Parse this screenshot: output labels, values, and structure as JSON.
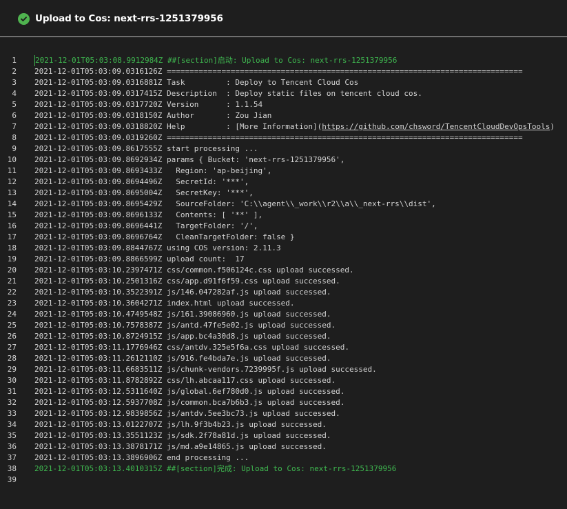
{
  "header": {
    "title": "Upload to Cos: next-rrs-1251379956",
    "status_icon": "check-circle-icon",
    "status_color": "#4fb34f"
  },
  "log": {
    "section_color": "#3fb950",
    "lines": [
      {
        "n": "1",
        "text": "2021-12-01T05:03:08.9912984Z ##[section]启动: Upload to Cos: next-rrs-1251379956",
        "section": true
      },
      {
        "n": "2",
        "text": "2021-12-01T05:03:09.0316126Z ==============================================================================",
        "section": false
      },
      {
        "n": "3",
        "text": "2021-12-01T05:03:09.0316881Z Task         : Deploy to Tencent Cloud Cos",
        "section": false
      },
      {
        "n": "4",
        "text": "2021-12-01T05:03:09.0317415Z Description  : Deploy static files on tencent cloud cos.",
        "section": false
      },
      {
        "n": "5",
        "text": "2021-12-01T05:03:09.0317720Z Version      : 1.1.54",
        "section": false
      },
      {
        "n": "6",
        "text": "2021-12-01T05:03:09.0318150Z Author       : Zou Jian",
        "section": false
      },
      {
        "n": "7",
        "text_before": "2021-12-01T05:03:09.0318820Z Help         : [More Information](",
        "link": "https://github.com/chsword/TencentCloudDevOpsTools",
        "text_after": ")",
        "section": false
      },
      {
        "n": "8",
        "text": "2021-12-01T05:03:09.0319260Z ==============================================================================",
        "section": false
      },
      {
        "n": "9",
        "text": "2021-12-01T05:03:09.8617555Z start processing ...",
        "section": false
      },
      {
        "n": "10",
        "text": "2021-12-01T05:03:09.8692934Z params { Bucket: 'next-rrs-1251379956',",
        "section": false
      },
      {
        "n": "11",
        "text": "2021-12-01T05:03:09.8693433Z   Region: 'ap-beijing',",
        "section": false
      },
      {
        "n": "12",
        "text": "2021-12-01T05:03:09.8694496Z   SecretId: '***',",
        "section": false
      },
      {
        "n": "13",
        "text": "2021-12-01T05:03:09.8695004Z   SecretKey: '***',",
        "section": false
      },
      {
        "n": "14",
        "text": "2021-12-01T05:03:09.8695429Z   SourceFolder: 'C:\\\\agent\\\\_work\\\\r2\\\\a\\\\_next-rrs\\\\dist',",
        "section": false
      },
      {
        "n": "15",
        "text": "2021-12-01T05:03:09.8696133Z   Contents: [ '**' ],",
        "section": false
      },
      {
        "n": "16",
        "text": "2021-12-01T05:03:09.8696441Z   TargetFolder: '/',",
        "section": false
      },
      {
        "n": "17",
        "text": "2021-12-01T05:03:09.8696764Z   CleanTargetFolder: false }",
        "section": false
      },
      {
        "n": "18",
        "text": "2021-12-01T05:03:09.8844767Z using COS version: 2.11.3",
        "section": false
      },
      {
        "n": "19",
        "text": "2021-12-01T05:03:09.8866599Z upload count:  17",
        "section": false
      },
      {
        "n": "20",
        "text": "2021-12-01T05:03:10.2397471Z css/common.f506124c.css upload successed.",
        "section": false
      },
      {
        "n": "21",
        "text": "2021-12-01T05:03:10.2501316Z css/app.d91f6f59.css upload successed.",
        "section": false
      },
      {
        "n": "22",
        "text": "2021-12-01T05:03:10.3522391Z js/146.047282af.js upload successed.",
        "section": false
      },
      {
        "n": "23",
        "text": "2021-12-01T05:03:10.3604271Z index.html upload successed.",
        "section": false
      },
      {
        "n": "24",
        "text": "2021-12-01T05:03:10.4749548Z js/161.39086960.js upload successed.",
        "section": false
      },
      {
        "n": "25",
        "text": "2021-12-01T05:03:10.7578387Z js/antd.47fe5e02.js upload successed.",
        "section": false
      },
      {
        "n": "26",
        "text": "2021-12-01T05:03:10.8724915Z js/app.bc4a30d8.js upload successed.",
        "section": false
      },
      {
        "n": "27",
        "text": "2021-12-01T05:03:11.1776946Z css/antdv.325e5f6a.css upload successed.",
        "section": false
      },
      {
        "n": "28",
        "text": "2021-12-01T05:03:11.2612110Z js/916.fe4bda7e.js upload successed.",
        "section": false
      },
      {
        "n": "29",
        "text": "2021-12-01T05:03:11.6683511Z js/chunk-vendors.7239995f.js upload successed.",
        "section": false
      },
      {
        "n": "30",
        "text": "2021-12-01T05:03:11.8782892Z css/lh.abcaa117.css upload successed.",
        "section": false
      },
      {
        "n": "31",
        "text": "2021-12-01T05:03:12.5311640Z js/global.6ef780d0.js upload successed.",
        "section": false
      },
      {
        "n": "32",
        "text": "2021-12-01T05:03:12.5937708Z js/common.bca7b6b3.js upload successed.",
        "section": false
      },
      {
        "n": "33",
        "text": "2021-12-01T05:03:12.9839856Z js/antdv.5ee3bc73.js upload successed.",
        "section": false
      },
      {
        "n": "34",
        "text": "2021-12-01T05:03:13.0122707Z js/lh.9f3b4b23.js upload successed.",
        "section": false
      },
      {
        "n": "35",
        "text": "2021-12-01T05:03:13.3551123Z js/sdk.2f78a81d.js upload successed.",
        "section": false
      },
      {
        "n": "36",
        "text": "2021-12-01T05:03:13.3878171Z js/md.a9e14865.js upload successed.",
        "section": false
      },
      {
        "n": "37",
        "text": "2021-12-01T05:03:13.3896906Z end processing ...",
        "section": false
      },
      {
        "n": "38",
        "text": "2021-12-01T05:03:13.4010315Z ##[section]完成: Upload to Cos: next-rrs-1251379956",
        "section": true
      },
      {
        "n": "39",
        "text": "",
        "section": false
      }
    ]
  }
}
